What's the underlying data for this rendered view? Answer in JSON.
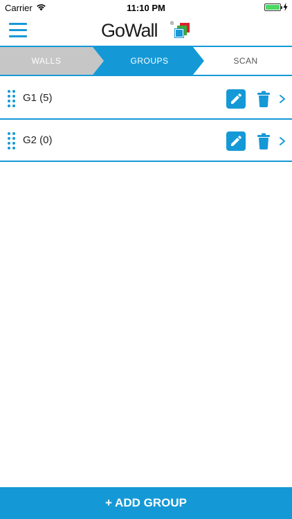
{
  "status_bar": {
    "carrier": "Carrier",
    "time": "11:10 PM",
    "wifi_icon": "wifi-icon",
    "battery_icon": "battery-full-icon",
    "charging_icon": "charging-bolt-icon"
  },
  "nav": {
    "menu_icon": "hamburger-menu-icon",
    "brand": "GoWall",
    "brand_mark": "®"
  },
  "tabs": [
    {
      "label": "WALLS",
      "state": "completed"
    },
    {
      "label": "GROUPS",
      "state": "active"
    },
    {
      "label": "SCAN",
      "state": "upcoming"
    }
  ],
  "groups": [
    {
      "label": "G1 (5)"
    },
    {
      "label": "G2 (0)"
    }
  ],
  "row_icons": {
    "drag": "drag-handle-icon",
    "edit": "pencil-icon",
    "delete": "trash-icon",
    "open": "chevron-right-icon"
  },
  "footer": {
    "add_group_label": "+ ADD GROUP"
  },
  "colors": {
    "accent": "#1599d6",
    "tab_completed": "#c6c6c6",
    "background": "#ffffff",
    "battery": "#4cd964",
    "logo_red": "#d9232e",
    "logo_green": "#3aaa35",
    "logo_blue": "#1599d6"
  }
}
